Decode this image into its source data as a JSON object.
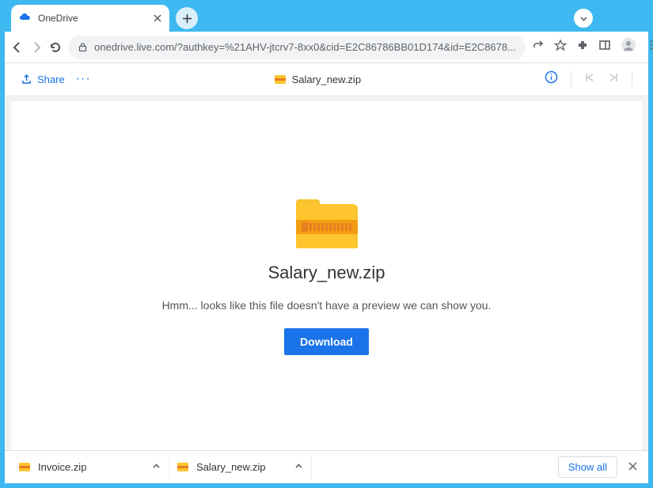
{
  "window": {
    "title": "OneDrive"
  },
  "browser": {
    "tab_title": "OneDrive",
    "url": "onedrive.live.com/?authkey=%21AHV-jtcrv7-8xx0&cid=E2C86786BB01D174&id=E2C8678..."
  },
  "onedrive_header": {
    "share_label": "Share",
    "more_label": "···",
    "filename": "Salary_new.zip"
  },
  "viewer": {
    "title": "Salary_new.zip",
    "message": "Hmm... looks like this file doesn't have a preview we can show you.",
    "download_label": "Download"
  },
  "downloads": {
    "items": [
      {
        "name": "Invoice.zip"
      },
      {
        "name": "Salary_new.zip"
      }
    ],
    "show_all_label": "Show all"
  }
}
